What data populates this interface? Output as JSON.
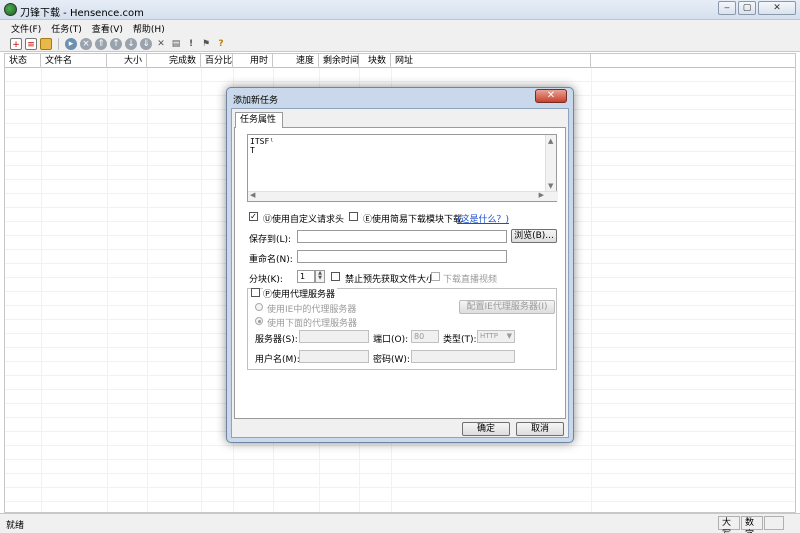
{
  "window": {
    "title": "刀锋下载 - Hensence.com",
    "btn_min": "‒",
    "btn_max": "▢",
    "btn_close": "✕"
  },
  "menu": [
    "文件(F)",
    "任务(T)",
    "查看(V)",
    "帮助(H)"
  ],
  "columns": [
    "状态",
    "文件名",
    "大小",
    "完成数",
    "百分比",
    "用时",
    "速度",
    "剩余时间",
    "块数",
    "网址"
  ],
  "status": {
    "text": "就绪",
    "caps": "大写",
    "num": "数字"
  },
  "dialog": {
    "title": "添加新任务",
    "close": "✕",
    "tab": "任务属性",
    "url_text": "ITSFˡ\nT",
    "opt_custom_header": "Ⓤ使用自定义请求头",
    "opt_easy_module": "Ⓔ使用简易下载模块下载",
    "what_link": "(这是什么？)",
    "save_to_label": "保存到(L):",
    "save_to_value": "",
    "browse_btn": "浏览(B)...",
    "rename_label": "重命名(N):",
    "rename_value": "",
    "blocks_label": "分块(K):",
    "blocks_value": "1",
    "no_prefetch": "禁止预先获取文件大小",
    "live_video": "下载直播视频",
    "use_proxy": "Ⓟ使用代理服务器",
    "use_ie_proxy": "使用IE中的代理服务器",
    "config_ie_proxy": "配置IE代理服务器(I)",
    "use_below_proxy": "使用下面的代理服务器",
    "server_label": "服务器(S):",
    "port_label": "端口(O):",
    "port_value": "80",
    "type_label": "类型(T):",
    "type_value": "HTTP",
    "user_label": "用户名(M):",
    "pass_label": "密码(W):",
    "ok": "确定",
    "cancel": "取消"
  }
}
